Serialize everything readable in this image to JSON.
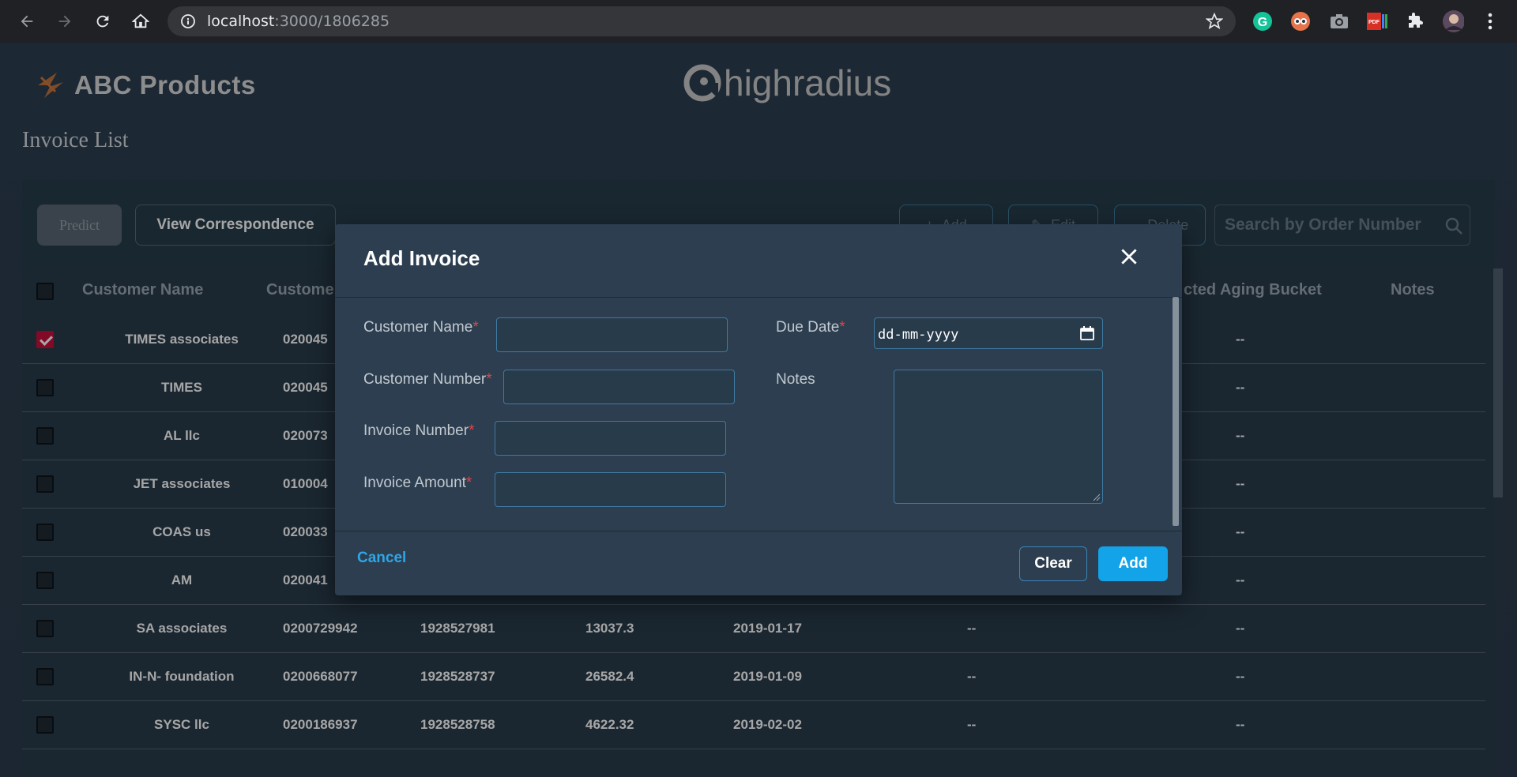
{
  "browser": {
    "url_host": "localhost",
    "url_path": ":3000/1806285"
  },
  "app": {
    "brand": "ABC Products",
    "partner_logo": "highradius",
    "page_title": "Invoice List"
  },
  "toolbar": {
    "predict": "Predict",
    "view_correspondence": "View Correspondence",
    "add": "Add",
    "edit": "Edit",
    "delete": "Delete",
    "search_placeholder": "Search by Order Number"
  },
  "table": {
    "headers": [
      "Customer Name",
      "Custome",
      "cted Aging Bucket",
      "Notes"
    ],
    "rows": [
      {
        "name": "TIMES associates",
        "number": "020045",
        "invoice": "",
        "amount": "",
        "due": "",
        "predicted": "",
        "bucket": "--",
        "checked": true
      },
      {
        "name": "TIMES",
        "number": "020045",
        "invoice": "",
        "amount": "",
        "due": "",
        "predicted": "",
        "bucket": "--",
        "checked": false
      },
      {
        "name": "AL llc",
        "number": "020073",
        "invoice": "",
        "amount": "",
        "due": "",
        "predicted": "",
        "bucket": "--",
        "checked": false
      },
      {
        "name": "JET associates",
        "number": "010004",
        "invoice": "",
        "amount": "",
        "due": "",
        "predicted": "",
        "bucket": "--",
        "checked": false
      },
      {
        "name": "COAS us",
        "number": "020033",
        "invoice": "",
        "amount": "",
        "due": "",
        "predicted": "",
        "bucket": "--",
        "checked": false
      },
      {
        "name": "AM",
        "number": "020041",
        "invoice": "",
        "amount": "",
        "due": "",
        "predicted": "",
        "bucket": "--",
        "checked": false
      },
      {
        "name": "SA associates",
        "number": "0200729942",
        "invoice": "1928527981",
        "amount": "13037.3",
        "due": "2019-01-17",
        "predicted": "--",
        "bucket": "--",
        "checked": false
      },
      {
        "name": "IN-N- foundation",
        "number": "0200668077",
        "invoice": "1928528737",
        "amount": "26582.4",
        "due": "2019-01-09",
        "predicted": "--",
        "bucket": "--",
        "checked": false
      },
      {
        "name": "SYSC llc",
        "number": "0200186937",
        "invoice": "1928528758",
        "amount": "4622.32",
        "due": "2019-02-02",
        "predicted": "--",
        "bucket": "--",
        "checked": false
      }
    ]
  },
  "modal": {
    "title": "Add Invoice",
    "fields": {
      "customer_name": "Customer Name",
      "customer_number": "Customer Number",
      "invoice_number": "Invoice Number",
      "invoice_amount": "Invoice Amount",
      "due_date": "Due Date",
      "notes": "Notes",
      "required_mark": "*"
    },
    "due_date_placeholder": "dd-mm-yyyy",
    "cancel": "Cancel",
    "clear": "Clear",
    "add": "Add"
  },
  "colors": {
    "accent": "#12a3e8",
    "required": "#e04646",
    "checkbox_checked": "#c8103b"
  }
}
